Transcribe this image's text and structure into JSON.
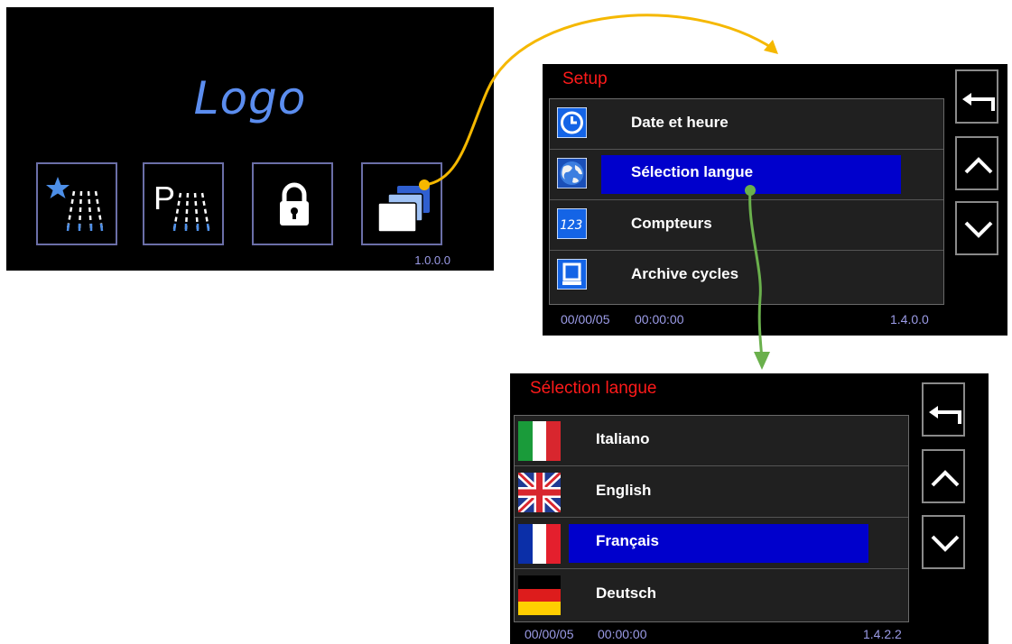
{
  "home": {
    "logo": "Logo",
    "version": "1.0.0.0",
    "buttons": [
      {
        "name": "favorite-wash-button",
        "icon": "star-spray-icon"
      },
      {
        "name": "program-wash-button",
        "icon": "p-spray-icon"
      },
      {
        "name": "lock-button",
        "icon": "lock-icon"
      },
      {
        "name": "menu-button",
        "icon": "stacked-cards-icon"
      }
    ]
  },
  "setup": {
    "title": "Setup",
    "items": [
      {
        "label": "Date et heure",
        "icon": "clock-icon",
        "selected": false
      },
      {
        "label": "Sélection langue",
        "icon": "globe-icon",
        "selected": true
      },
      {
        "label": "Compteurs",
        "icon": "counter-icon",
        "selected": false
      },
      {
        "label": "Archive cycles",
        "icon": "monitor-icon",
        "selected": false
      }
    ],
    "status": {
      "date": "00/00/05",
      "time": "00:00:00",
      "version": "1.4.0.0"
    }
  },
  "languages": {
    "title": "Sélection langue",
    "items": [
      {
        "label": "Italiano",
        "icon": "italy-flag-icon",
        "selected": false
      },
      {
        "label": "English",
        "icon": "uk-flag-icon",
        "selected": false
      },
      {
        "label": "Français",
        "icon": "france-flag-icon",
        "selected": true
      },
      {
        "label": "Deutsch",
        "icon": "germany-flag-icon",
        "selected": false
      }
    ],
    "status": {
      "date": "00/00/05",
      "time": "00:00:00",
      "version": "1.4.2.2"
    }
  },
  "colors": {
    "screen_bg": "#000000",
    "title_red": "#ff1a1a",
    "selection_blue": "#0000cc",
    "logo_blue": "#5b8def",
    "status_text": "#9c9ce8",
    "connector_orange": "#f5b800",
    "connector_green": "#6ab04c"
  }
}
